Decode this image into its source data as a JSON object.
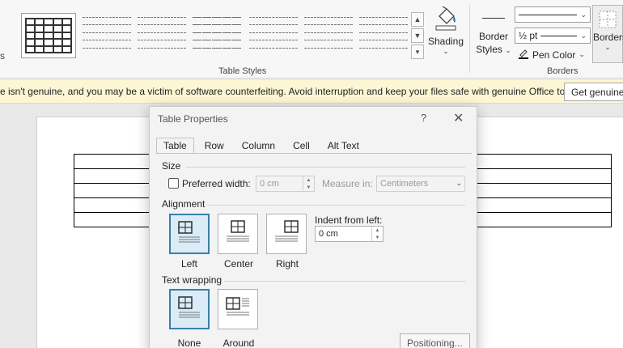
{
  "ribbon": {
    "edge_fragment": "s",
    "table_styles_label": "Table Styles",
    "shading_label": "Shading",
    "border_styles_label_line1": "Border",
    "border_styles_label_line2": "Styles",
    "pen_weight": "½ pt",
    "pen_color_label": "Pen Color",
    "borders_group_label": "Borders",
    "borders_button_label": "Borders",
    "accent_color": "#2b579a"
  },
  "notice": {
    "text": "e isn't genuine, and you may be a victim of software counterfeiting. Avoid interruption and keep your files safe with genuine Office today.",
    "button_label": "Get genuine Office"
  },
  "dialog": {
    "title": "Table Properties",
    "help": "?",
    "close": "✕",
    "tabs": [
      "Table",
      "Row",
      "Column",
      "Cell",
      "Alt Text"
    ],
    "active_tab": "Table",
    "size": {
      "section_label": "Size",
      "preferred_width_label": "Preferred width:",
      "preferred_width_checked": false,
      "width_value": "0 cm",
      "measure_in_label": "Measure in:",
      "measure_in_value": "Centimeters"
    },
    "alignment": {
      "section_label": "Alignment",
      "options": [
        "Left",
        "Center",
        "Right"
      ],
      "selected": "Left",
      "indent_label": "Indent from left:",
      "indent_value": "0 cm"
    },
    "text_wrapping": {
      "section_label": "Text wrapping",
      "options": [
        "None",
        "Around"
      ],
      "selected": "None",
      "positioning_label": "Positioning..."
    }
  },
  "document": {
    "table_rows": 5
  }
}
